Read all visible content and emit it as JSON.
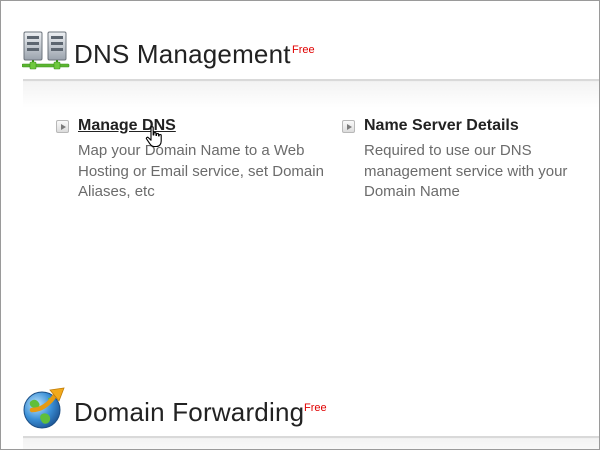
{
  "dns_section": {
    "title": "DNS Management",
    "badge": "Free",
    "icon": "server-network-icon"
  },
  "items": [
    {
      "label": "Manage DNS",
      "description": "Map your Domain Name to a Web Hosting or Email service, set Domain Aliases, etc"
    },
    {
      "label": "Name Server Details",
      "description": "Required to use our DNS management service with your Domain Name"
    }
  ],
  "forwarding_section": {
    "title": "Domain Forwarding",
    "badge": "Free",
    "icon": "globe-forward-icon"
  },
  "colors": {
    "badge": "#e00000",
    "description_text": "#6b6b6b",
    "link_text": "#222222"
  }
}
